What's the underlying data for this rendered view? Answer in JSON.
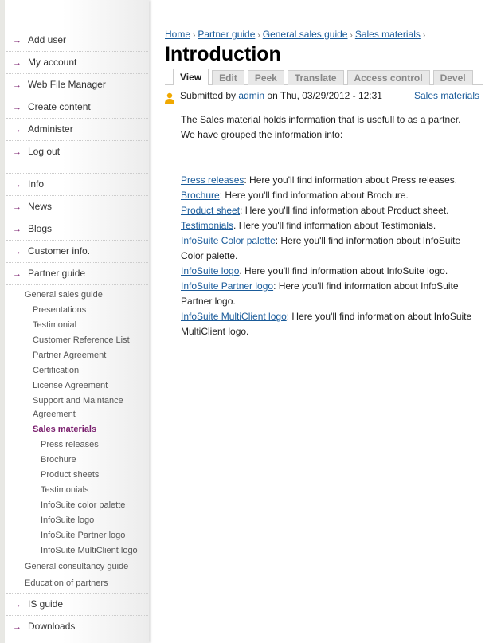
{
  "sidebar": {
    "admin_menu": [
      "Add user",
      "My account",
      "Web File Manager",
      "Create content",
      "Administer",
      "Log out"
    ],
    "main_menu": [
      "Info",
      "News",
      "Blogs",
      "Customer info.",
      "Partner guide"
    ],
    "partner_guide": {
      "general_sales_guide": "General sales guide",
      "items": [
        "Presentations",
        "Testimonial",
        "Customer Reference List",
        "Partner Agreement",
        "Certification",
        "License Agreement",
        "Support and Maintance Agreement"
      ],
      "sales_materials": "Sales materials",
      "sales_items": [
        "Press releases",
        "Brochure",
        "Product sheets",
        "Testimonials",
        "InfoSuite color palette",
        "InfoSuite logo",
        "InfoSuite Partner logo",
        "InfoSuite MultiClient logo"
      ],
      "general_consultancy_guide": "General consultancy guide",
      "education": "Education of partners"
    },
    "bottom_menu": [
      "IS guide",
      "Downloads"
    ]
  },
  "breadcrumb": [
    "Home",
    "Partner guide",
    "General sales guide",
    "Sales materials"
  ],
  "title": "Introduction",
  "tabs": [
    "View",
    "Edit",
    "Peek",
    "Translate",
    "Access control",
    "Devel"
  ],
  "meta": {
    "submitted_by": "Submitted by",
    "author": "admin",
    "date": "on Thu, 03/29/2012 - 12:31",
    "category": "Sales materials"
  },
  "intro": [
    "The Sales material holds information that is usefull to as a partner.",
    "We have grouped the information into:"
  ],
  "links": [
    {
      "link": "Press releases",
      "text": ": Here you'll find information about Press releases."
    },
    {
      "link": "Brochure",
      "text": ": Here you'll find information about Brochure."
    },
    {
      "link": "Product sheet",
      "text": ": Here you'll find information about Product sheet."
    },
    {
      "link": "Testimonials",
      "text": ". Here you'll find information about Testimonials."
    },
    {
      "link": "InfoSuite Color palette",
      "text": ": Here you'll find information about InfoSuite Color palette."
    },
    {
      "link": "InfoSuite logo",
      "text": ". Here you'll find information about InfoSuite logo."
    },
    {
      "link": "InfoSuite Partner logo",
      "text": ": Here you'll find information about InfoSuite Partner logo."
    },
    {
      "link": "InfoSuite MultiClient logo",
      "text": ": Here you'll find information about InfoSuite MultiClient logo."
    }
  ]
}
